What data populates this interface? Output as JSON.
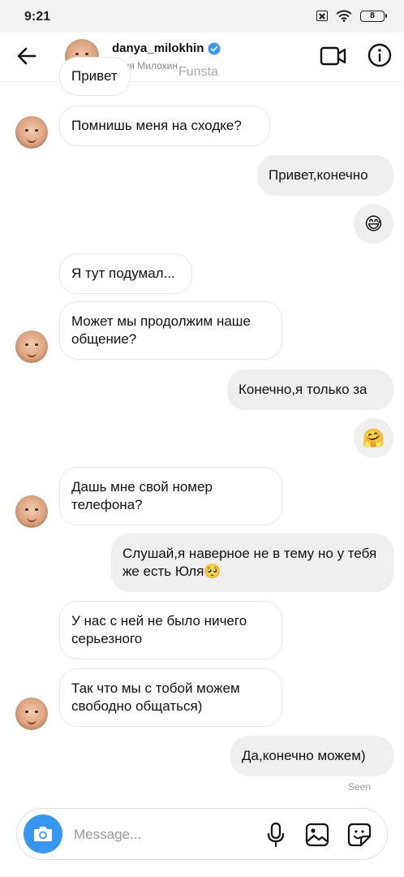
{
  "status_bar": {
    "time": "9:21",
    "battery": "8"
  },
  "header": {
    "username": "danya_milokhin",
    "full_name": "Даня Милохин",
    "watermark": "Funsta"
  },
  "messages": [
    {
      "id": "m0",
      "side": "in",
      "text": "Привет"
    },
    {
      "id": "m1",
      "side": "in",
      "text": "Помнишь меня на сходке?"
    },
    {
      "id": "m2",
      "side": "out",
      "text": "Привет,конечно"
    },
    {
      "id": "m3",
      "side": "out",
      "emoji": "😅"
    },
    {
      "id": "m4",
      "side": "in",
      "text": "Я тут подумал..."
    },
    {
      "id": "m5",
      "side": "in",
      "text": "Может мы продолжим наше общение?"
    },
    {
      "id": "m6",
      "side": "out",
      "text": "Конечно,я только за"
    },
    {
      "id": "m7",
      "side": "out",
      "emoji": "🤗"
    },
    {
      "id": "m8",
      "side": "in",
      "text": "Дашь мне свой номер телефона?"
    },
    {
      "id": "m9",
      "side": "out",
      "text": "Слушай,я наверное не в тему но у тебя же есть Юля🥺"
    },
    {
      "id": "m10",
      "side": "in",
      "text": "У нас с ней не было ничего серьезного"
    },
    {
      "id": "m11",
      "side": "in",
      "text": "Так что мы с тобой можем свободно общаться)"
    },
    {
      "id": "m12",
      "side": "out",
      "text": "Да,конечно можем)"
    }
  ],
  "seen_label": "Seen",
  "composer": {
    "placeholder": "Message..."
  },
  "colors": {
    "accent": "#3797f0",
    "online": "#1bbf3a",
    "verified": "#3897f0",
    "out_bubble": "#efefef"
  },
  "icons": [
    "back-arrow-icon",
    "verified-icon",
    "video-camera-icon",
    "info-icon",
    "camera-icon",
    "microphone-icon",
    "gallery-icon",
    "sticker-icon"
  ]
}
